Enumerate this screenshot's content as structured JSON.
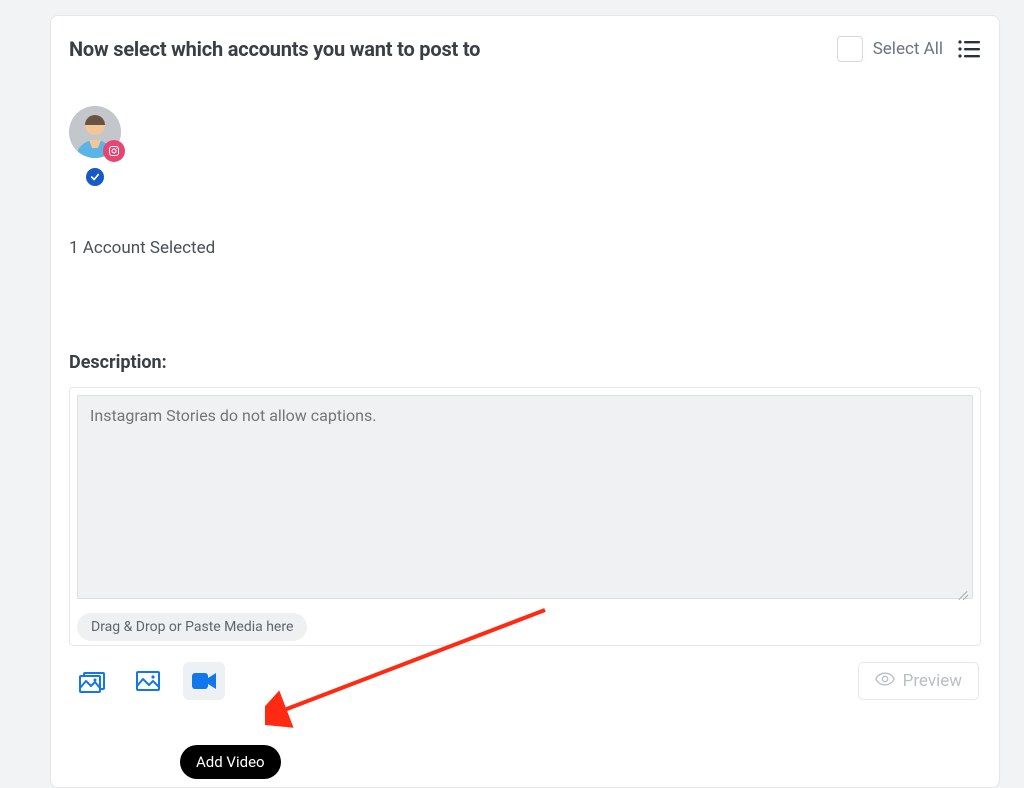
{
  "header": {
    "title": "Now select which accounts you want to post to",
    "select_all_label": "Select All"
  },
  "accounts": {
    "selected_count_text": "1 Account Selected"
  },
  "description": {
    "label": "Description:",
    "placeholder": "Instagram Stories do not allow captions.",
    "drag_drop_hint": "Drag & Drop or Paste Media here"
  },
  "toolbar": {
    "preview_label": "Preview",
    "tooltip_add_video": "Add Video"
  }
}
